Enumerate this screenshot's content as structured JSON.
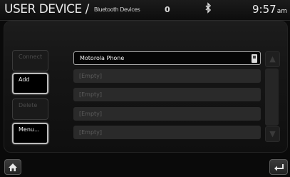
{
  "header": {
    "title": "USER DEVICE /",
    "subtitle": "Bluetooth Devices",
    "count": "0",
    "time": "9:57",
    "ampm": "am"
  },
  "actions": {
    "connect": "Connect",
    "add": "Add",
    "delete": "Delete",
    "menu": "Menu..."
  },
  "devices": [
    "Motorola Phone",
    "[Empty]",
    "[Empty]",
    "[Empty]",
    "[Empty]"
  ],
  "icons": {
    "home": "home-icon",
    "back": "back-icon",
    "bluetooth": "bluetooth-icon",
    "phone": "phone-icon",
    "up": "scroll-up-icon",
    "down": "scroll-down-icon"
  }
}
